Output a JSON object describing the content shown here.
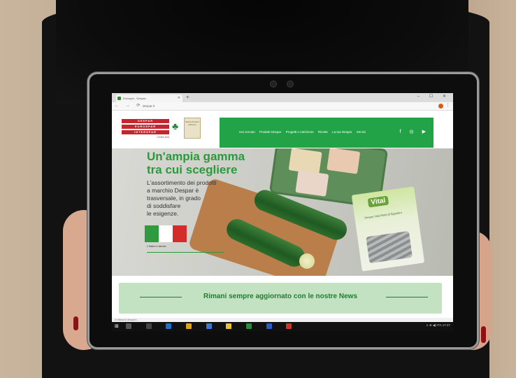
{
  "scene": {
    "description_free": true
  },
  "browser": {
    "tab_title": "Eurospin - Despar... ",
    "url": "despar.it",
    "new_tab": "+",
    "window_controls": "–  ☐  ✕",
    "nav_buttons": "←  →  ⟳"
  },
  "site": {
    "logo_lines": [
      "DESPAR",
      "EUROSPAR",
      "INTERSPAR"
    ],
    "logo_sub": "Centro Sud",
    "badge_text": "Eletta Prodotto dell'anno",
    "nav": [
      "Hai cercato",
      "Prodotti Despar",
      "Progetti e nutrizione",
      "Ricette",
      "La tua Despar",
      "Servizi"
    ],
    "social": "f  ◎  ▶"
  },
  "hero": {
    "title_line1": "Un'ampia gamma",
    "title_line2": "tra cui scegliere",
    "text_lines": [
      "L'assortimento dei prodotti",
      "a marchio Despar è",
      "trasversale, in grado",
      "di soddisfare",
      "le esigenze."
    ],
    "flag_label": "L'Italia in tavola",
    "package_brand": "Vital",
    "package_text": "Despar Vital Filetti di Sgombro"
  },
  "news": {
    "text": "Rimani sempre aggiornato con le nostre News"
  },
  "status": {
    "text": "In attesa di despar.it..."
  },
  "taskbar": {
    "start": "⊞",
    "tray": "∧  ⊕  ◀)  ITA  17:47"
  },
  "colors": {
    "brand_green": "#23a347",
    "brand_red": "#c3262e",
    "news_bg": "#c3e2c2"
  }
}
